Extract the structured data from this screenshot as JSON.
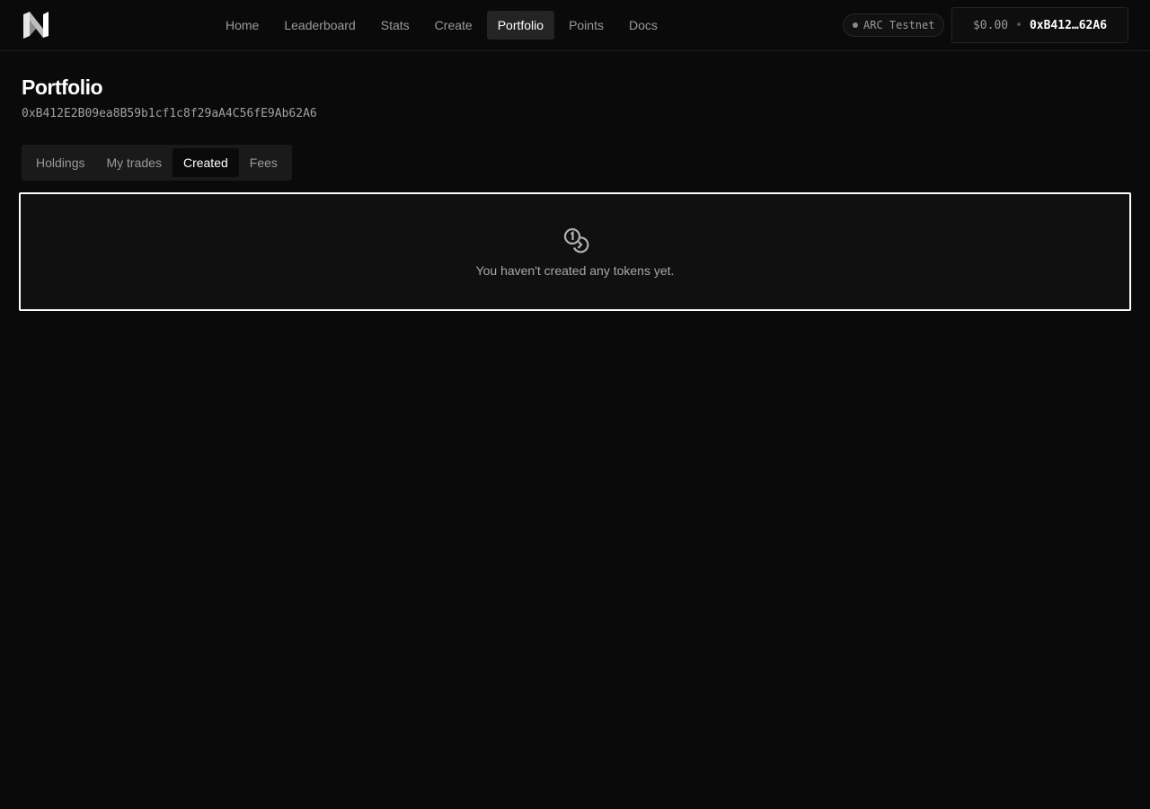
{
  "nav": {
    "items": [
      {
        "label": "Home",
        "active": false
      },
      {
        "label": "Leaderboard",
        "active": false
      },
      {
        "label": "Stats",
        "active": false
      },
      {
        "label": "Create",
        "active": false
      },
      {
        "label": "Portfolio",
        "active": true
      },
      {
        "label": "Points",
        "active": false
      },
      {
        "label": "Docs",
        "active": false
      }
    ]
  },
  "network": {
    "label": "ARC Testnet"
  },
  "wallet": {
    "balance": "$0.00",
    "separator": "•",
    "address": "0xB412…62A6"
  },
  "page": {
    "title": "Portfolio",
    "address": "0xB412E2B09ea8B59b1cf1c8f29aA4C56fE9Ab62A6"
  },
  "tabs": [
    {
      "label": "Holdings",
      "active": false
    },
    {
      "label": "My trades",
      "active": false
    },
    {
      "label": "Created",
      "active": true
    },
    {
      "label": "Fees",
      "active": false
    }
  ],
  "empty_state": {
    "icon": "coins-icon",
    "message": "You haven't created any tokens yet."
  },
  "colors": {
    "background": "#0a0a0a",
    "active_nav": "#242424",
    "muted_text": "#9a9a9a"
  }
}
